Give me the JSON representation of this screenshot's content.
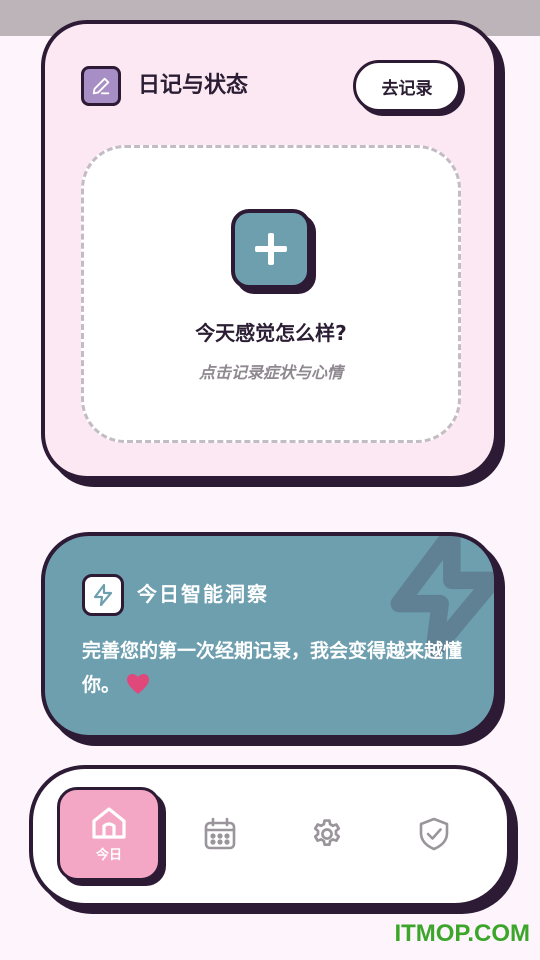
{
  "diary": {
    "title": "日记与状态",
    "record_button": "去记录",
    "prompt_title": "今天感觉怎么样?",
    "prompt_subtitle": "点击记录症状与心情",
    "header_icon": "pencil-icon",
    "add_icon": "plus-icon"
  },
  "insight": {
    "title": "今日智能洞察",
    "message": "完善您的第一次经期记录，我会变得越来越懂你。",
    "icon": "lightning-icon"
  },
  "nav": {
    "items": [
      {
        "label": "今日",
        "icon": "home-icon",
        "active": true
      },
      {
        "label": "",
        "icon": "calendar-icon",
        "active": false
      },
      {
        "label": "",
        "icon": "gear-icon",
        "active": false
      },
      {
        "label": "",
        "icon": "shield-check-icon",
        "active": false
      }
    ]
  },
  "watermark": "ITMOP.COM",
  "colors": {
    "pink_card": "#fbe8f2",
    "teal": "#6e9faf",
    "purple_icon": "#a78ec4",
    "pink_active": "#f4a7c4",
    "outline": "#2d1a35",
    "heart": "#e0487c"
  }
}
